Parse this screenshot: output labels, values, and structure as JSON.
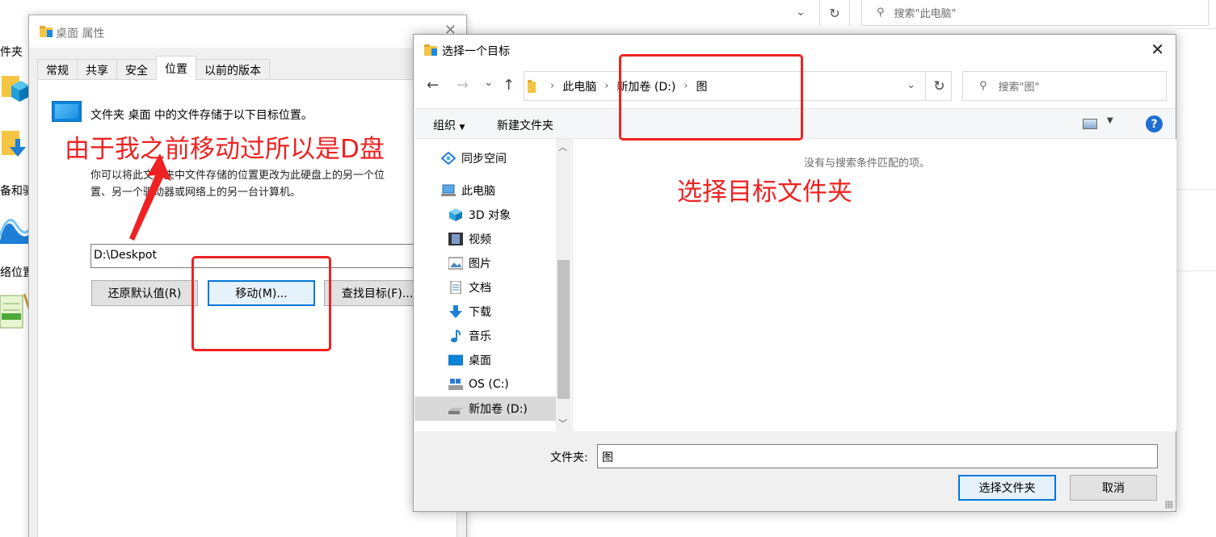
{
  "background": {
    "search_placeholder": "搜索\"此电脑\"",
    "left_labels": [
      "件夹",
      "备和驱",
      "络位置"
    ]
  },
  "props_dialog": {
    "title": "桌面 属性",
    "tabs": [
      "常规",
      "共享",
      "安全",
      "位置",
      "以前的版本"
    ],
    "active_tab": "位置",
    "location_text": "文件夹 桌面 中的文件存储于以下目标位置。",
    "description_line1": "你可以将此文件夹中文件存储的位置更改为此硬盘上的另一个位",
    "description_line2": "置、另一个驱动器或网络上的另一台计算机。",
    "path_value": "D:\\Deskpot",
    "restore_button": "还原默认值(R)",
    "move_button": "移动(M)...",
    "find_button": "查找目标(F)..."
  },
  "picker_dialog": {
    "title": "选择一个目标",
    "breadcrumb": [
      "此电脑",
      "新加卷 (D:)",
      "图"
    ],
    "search_placeholder": "搜索\"图\"",
    "toolbar": {
      "organize": "组织",
      "new_folder": "新建文件夹"
    },
    "nav_items": [
      {
        "label": "同步空间",
        "icon": "sync-space-icon"
      },
      {
        "label": "此电脑",
        "icon": "this-pc-icon"
      },
      {
        "label": "3D 对象",
        "icon": "3d-objects-icon"
      },
      {
        "label": "视频",
        "icon": "video-icon"
      },
      {
        "label": "图片",
        "icon": "pictures-icon"
      },
      {
        "label": "文档",
        "icon": "documents-icon"
      },
      {
        "label": "下载",
        "icon": "downloads-icon"
      },
      {
        "label": "音乐",
        "icon": "music-icon"
      },
      {
        "label": "桌面",
        "icon": "desktop-icon"
      },
      {
        "label": "OS (C:)",
        "icon": "drive-c-icon"
      },
      {
        "label": "新加卷 (D:)",
        "icon": "drive-d-icon"
      }
    ],
    "selected_nav": "新加卷 (D:)",
    "empty_message": "没有与搜索条件匹配的项。",
    "folder_label": "文件夹:",
    "folder_value": "图",
    "select_button": "选择文件夹",
    "cancel_button": "取消"
  },
  "annotations": {
    "left_note": "由于我之前移动过所以是D盘",
    "right_note": "选择目标文件夹",
    "color": "#ee2222"
  }
}
